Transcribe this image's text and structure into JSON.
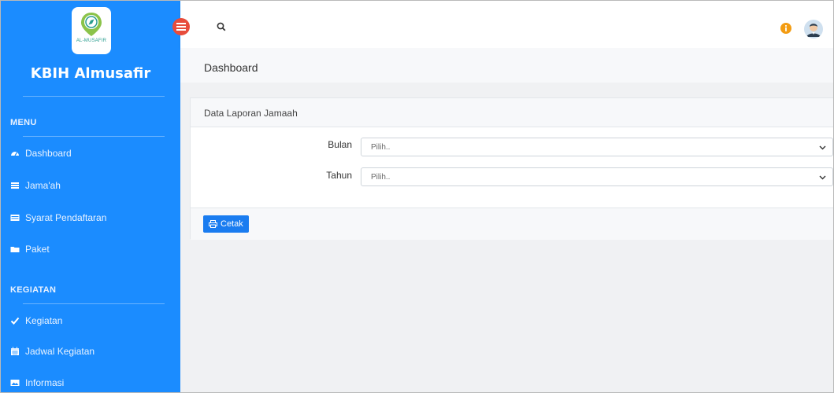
{
  "sidebar": {
    "logo_text": "AL-MUSAFIR",
    "brand": "KBIH Almusafir",
    "menu_title": "MENU",
    "menu_items": [
      {
        "label": "Dashboard",
        "icon": "dashboard-icon"
      },
      {
        "label": "Jama'ah",
        "icon": "list-icon"
      },
      {
        "label": "Syarat Pendaftaran",
        "icon": "id-card-icon"
      },
      {
        "label": "Paket",
        "icon": "folder-icon"
      }
    ],
    "kegiatan_title": "KEGIATAN",
    "kegiatan_items": [
      {
        "label": "Kegiatan",
        "icon": "check-icon"
      },
      {
        "label": "Jadwal Kegiatan",
        "icon": "calendar-icon"
      },
      {
        "label": "Informasi",
        "icon": "image-icon"
      }
    ]
  },
  "header": {
    "page_title": "Dashboard"
  },
  "card": {
    "title": "Data Laporan Jamaah",
    "fields": [
      {
        "label": "Bulan",
        "value": "Pilih.."
      },
      {
        "label": "Tahun",
        "value": "Pilih.."
      }
    ],
    "print_button": "Cetak"
  },
  "colors": {
    "sidebar": "#1b8cff",
    "toggle": "#e74c3c",
    "info": "#f39c12",
    "button": "#1a7cf0"
  }
}
